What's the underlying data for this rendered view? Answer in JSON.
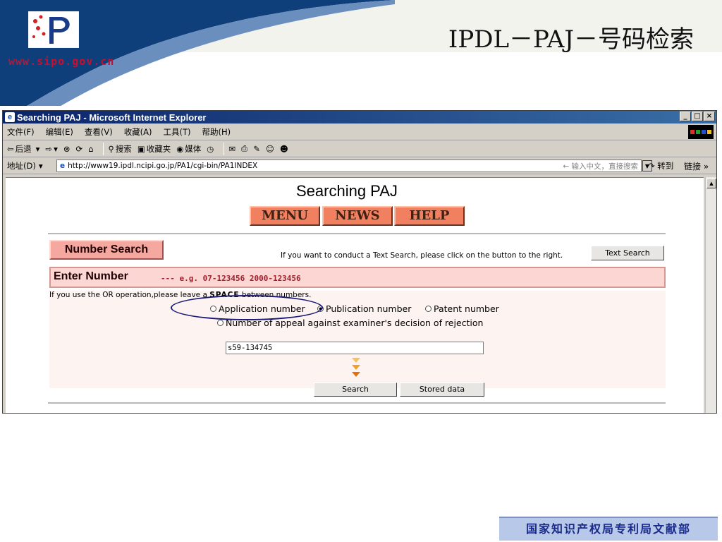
{
  "slide": {
    "title": "IPDL－PAJ－号码检索",
    "site_url": "www.sipo.gov.cn",
    "footer": "国家知识产权局专利局文献部"
  },
  "browser": {
    "window_title": "Searching PAJ - Microsoft Internet Explorer",
    "menu": [
      "文件(F)",
      "编辑(E)",
      "查看(V)",
      "收藏(A)",
      "工具(T)",
      "帮助(H)"
    ],
    "toolbar": {
      "back": "后退",
      "search": "搜索",
      "favorites": "收藏夹",
      "media": "媒体"
    },
    "address_label": "地址(D)",
    "address_url": "http://www19.ipdl.ncipi.go.jp/PA1/cgi-bin/PA1INDEX",
    "search_hint": "输入中文，直接搜索",
    "go_label": "转到",
    "links_label": "链接"
  },
  "page": {
    "title": "Searching PAJ",
    "nav": [
      "MENU",
      "NEWS",
      "HELP"
    ],
    "number_search_label": "Number Search",
    "text_search_hint": "If you want to conduct a Text Search, please click on the button to the right.",
    "text_search_button": "Text Search",
    "enter_title": "Enter Number",
    "enter_example": "--- e.g. 07-123456 2000-123456",
    "or_hint_pre": "If you use the OR operation,please leave a",
    "or_hint_space": "SPACE",
    "or_hint_post": "between numbers.",
    "radio_options": [
      "Application number",
      "Publication number",
      "Patent number",
      "Number of appeal against examiner's decision of rejection"
    ],
    "selected_radio": "Publication number",
    "number_input_value": "s59-134745",
    "search_button": "Search",
    "stored_data_button": "Stored data"
  },
  "colors": {
    "nav_button": "#f08060",
    "number_search": "#f4a8a0",
    "enter_bar": "#fbd6d2",
    "circle_annotation": "#1a1a7a"
  }
}
